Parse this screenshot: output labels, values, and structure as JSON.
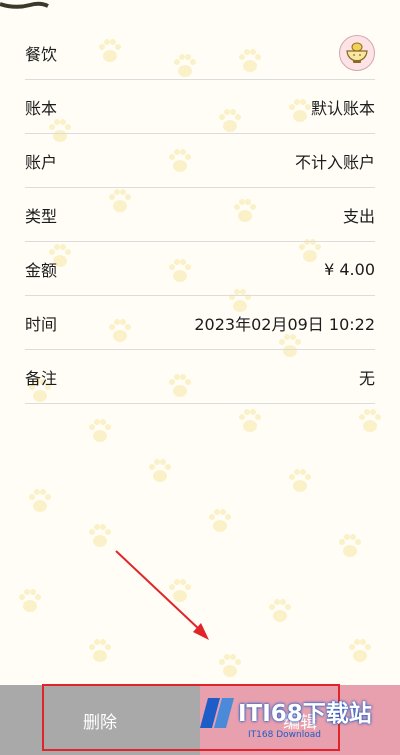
{
  "rows": [
    {
      "label": "餐饮",
      "value": "",
      "icon": "rice-bowl-icon"
    },
    {
      "label": "账本",
      "value": "默认账本"
    },
    {
      "label": "账户",
      "value": "不计入账户"
    },
    {
      "label": "类型",
      "value": "支出"
    },
    {
      "label": "金额",
      "value": "¥ 4.00"
    },
    {
      "label": "时间",
      "value": "2023年02月09日 10:22"
    },
    {
      "label": "备注",
      "value": "无"
    }
  ],
  "bottom_bar": {
    "delete_label": "删除",
    "edit_label": "编辑"
  },
  "watermark": {
    "text": "ITI68下载站",
    "subtext": "IT168 Download"
  },
  "colors": {
    "background": "#fffdf6",
    "bar": "#a9a9a9",
    "edit_button": "#e8a0ae",
    "highlight": "#e0252a",
    "icon_bg": "#fde2e6"
  }
}
